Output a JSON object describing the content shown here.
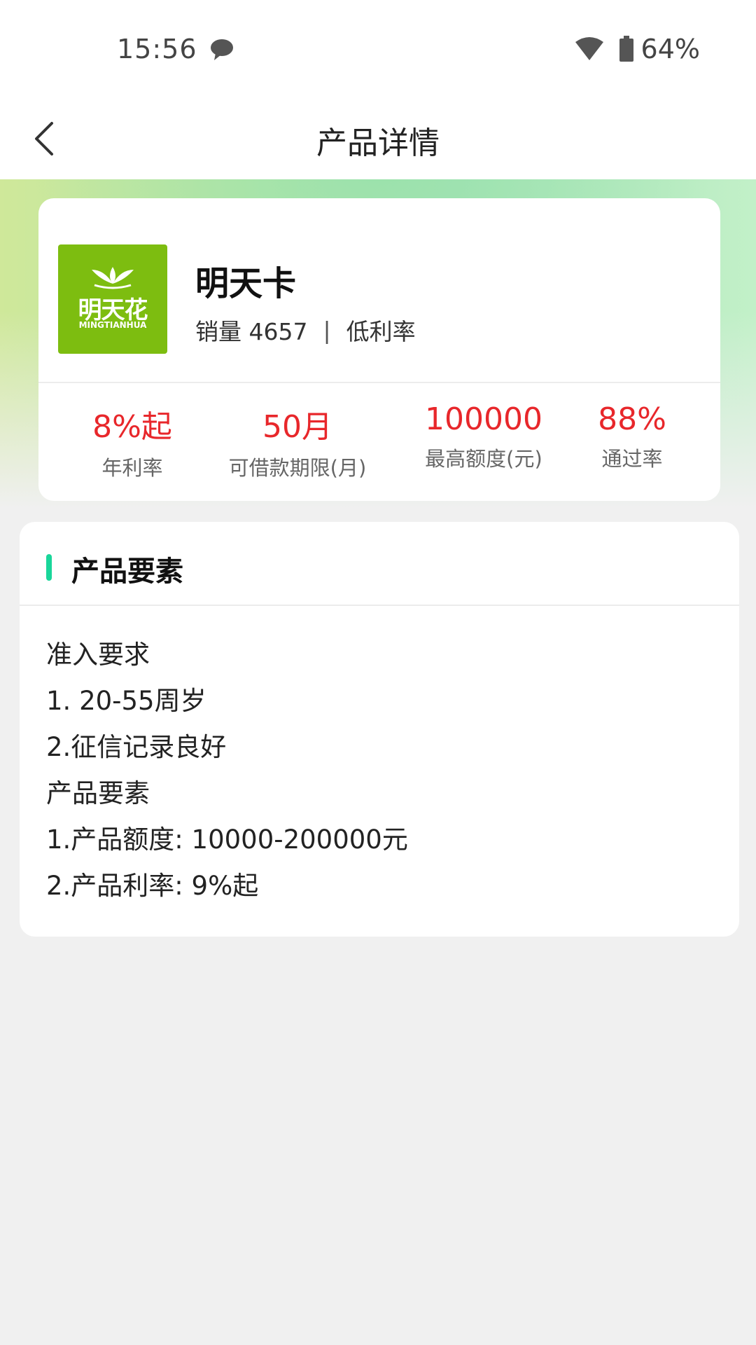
{
  "status_bar": {
    "time": "15:56",
    "battery": "64%"
  },
  "nav": {
    "title": "产品详情"
  },
  "product": {
    "name": "明天卡",
    "logo_text": "明天花",
    "logo_subtext": "MINGTIANHUA",
    "sales_label": "销量 4657",
    "divider": "|",
    "tag": "低利率",
    "stats": [
      {
        "value": "8%起",
        "label": "年利率"
      },
      {
        "value": "50月",
        "label": "可借款期限(月)"
      },
      {
        "value": "100000",
        "label": "最高额度(元)"
      },
      {
        "value": "88%",
        "label": "通过率"
      }
    ]
  },
  "elements": {
    "title": "产品要素",
    "lines": [
      "准入要求",
      "1. 20-55周岁",
      "2.征信记录良好",
      "产品要素",
      "1.产品额度: 10000-200000元",
      "2.产品利率: 9%起"
    ]
  },
  "colors": {
    "accent": "#19d69a",
    "stat_value": "#e8272b",
    "logo_bg": "#7dbd10"
  }
}
